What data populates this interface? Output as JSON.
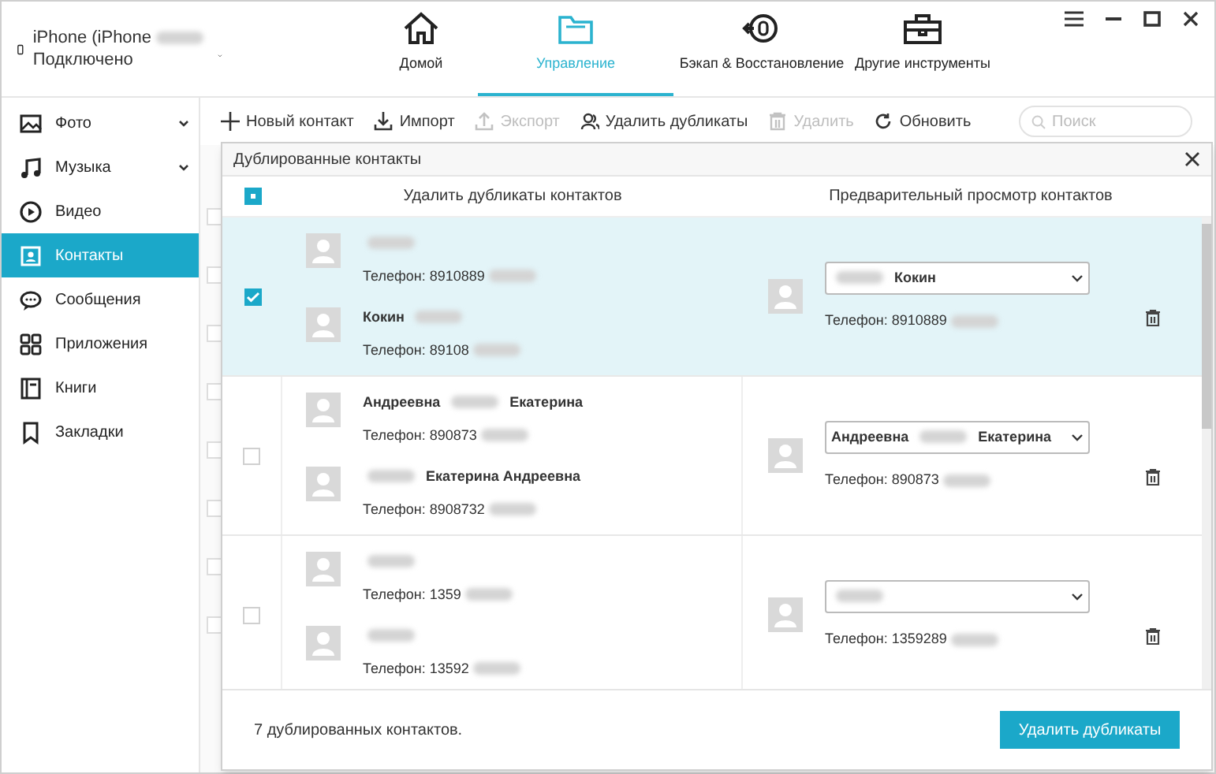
{
  "device": {
    "name": [
      {
        "kind": "text",
        "text": "iPhone (iPhone"
      },
      {
        "kind": "redacted"
      }
    ],
    "status": "Подключено"
  },
  "nav_tabs": [
    {
      "label": "Домой",
      "selected": false
    },
    {
      "label": "Управление",
      "selected": true
    },
    {
      "label": "Бэкап & Восстановление",
      "selected": false
    },
    {
      "label": "Другие инструменты",
      "selected": false
    }
  ],
  "sidebar": {
    "items": [
      {
        "label": "Фото",
        "expandable": true,
        "selected": false
      },
      {
        "label": "Музыка",
        "expandable": true,
        "selected": false
      },
      {
        "label": "Видео",
        "expandable": false,
        "selected": false
      },
      {
        "label": "Контакты",
        "expandable": false,
        "selected": true
      },
      {
        "label": "Сообщения",
        "expandable": false,
        "selected": false
      },
      {
        "label": "Приложения",
        "expandable": false,
        "selected": false
      },
      {
        "label": "Книги",
        "expandable": false,
        "selected": false
      },
      {
        "label": "Закладки",
        "expandable": false,
        "selected": false
      }
    ]
  },
  "toolbar": [
    {
      "label": "Новый контакт",
      "disabled": false
    },
    {
      "label": "Импорт",
      "disabled": false
    },
    {
      "label": "Экспорт",
      "disabled": true
    },
    {
      "label": "Удалить дубликаты",
      "disabled": false
    },
    {
      "label": "Удалить",
      "disabled": true
    },
    {
      "label": "Обновить",
      "disabled": false
    }
  ],
  "search": {
    "placeholder": "Поиск"
  },
  "contact_list": {
    "rows": [
      {
        "checked": false
      },
      {
        "checked": false
      },
      {
        "checked": false
      },
      {
        "checked": false
      },
      {
        "checked": false
      },
      {
        "checked": false
      },
      {
        "checked": false
      },
      {
        "checked": false
      }
    ]
  },
  "dialog": {
    "title": "Дублированные контакты",
    "select_all_indeterminate": true,
    "columns": [
      "Удалить дубликаты контактов",
      "Предварительный просмотр контактов"
    ],
    "groups": [
      {
        "checked": true,
        "selected": true,
        "contacts": [
          {
            "name": [
              {
                "kind": "redacted"
              }
            ],
            "phone": [
              {
                "kind": "text",
                "text": "Телефон: 8910889"
              },
              {
                "kind": "redacted"
              }
            ]
          },
          {
            "name": [
              {
                "kind": "text",
                "text": "Кокин"
              },
              {
                "kind": "redacted"
              }
            ],
            "phone": [
              {
                "kind": "text",
                "text": "Телефон: 89108"
              },
              {
                "kind": "redacted"
              }
            ]
          }
        ],
        "merged": {
          "name": [
            {
              "kind": "redacted"
            },
            {
              "kind": "text",
              "text": "Кокин"
            }
          ],
          "phone": [
            {
              "kind": "text",
              "text": "Телефон: 8910889"
            },
            {
              "kind": "redacted"
            }
          ]
        }
      },
      {
        "checked": false,
        "selected": false,
        "contacts": [
          {
            "name": [
              {
                "kind": "text",
                "text": "Андреевна"
              },
              {
                "kind": "redacted"
              },
              {
                "kind": "text",
                "text": "Екатерина"
              }
            ],
            "phone": [
              {
                "kind": "text",
                "text": "Телефон: 890873"
              },
              {
                "kind": "redacted"
              }
            ]
          },
          {
            "name": [
              {
                "kind": "redacted"
              },
              {
                "kind": "text",
                "text": "Екатерина Андреевна"
              }
            ],
            "phone": [
              {
                "kind": "text",
                "text": "Телефон: 8908732"
              },
              {
                "kind": "redacted"
              }
            ]
          }
        ],
        "merged": {
          "name": [
            {
              "kind": "text",
              "text": "Андреевна"
            },
            {
              "kind": "redacted"
            },
            {
              "kind": "text",
              "text": "Екатерина"
            }
          ],
          "phone": [
            {
              "kind": "text",
              "text": "Телефон: 890873"
            },
            {
              "kind": "redacted"
            }
          ]
        }
      },
      {
        "checked": false,
        "selected": false,
        "contacts": [
          {
            "name": [
              {
                "kind": "redacted"
              }
            ],
            "phone": [
              {
                "kind": "text",
                "text": "Телефон: 1359"
              },
              {
                "kind": "redacted"
              }
            ]
          },
          {
            "name": [
              {
                "kind": "redacted"
              }
            ],
            "phone": [
              {
                "kind": "text",
                "text": "Телефон: 13592"
              },
              {
                "kind": "redacted"
              }
            ]
          }
        ],
        "merged": {
          "name": [
            {
              "kind": "redacted"
            }
          ],
          "phone": [
            {
              "kind": "text",
              "text": "Телефон: 1359289"
            },
            {
              "kind": "redacted"
            }
          ]
        }
      }
    ],
    "summary": "7 дублированных контактов.",
    "action": "Удалить дубликаты"
  }
}
